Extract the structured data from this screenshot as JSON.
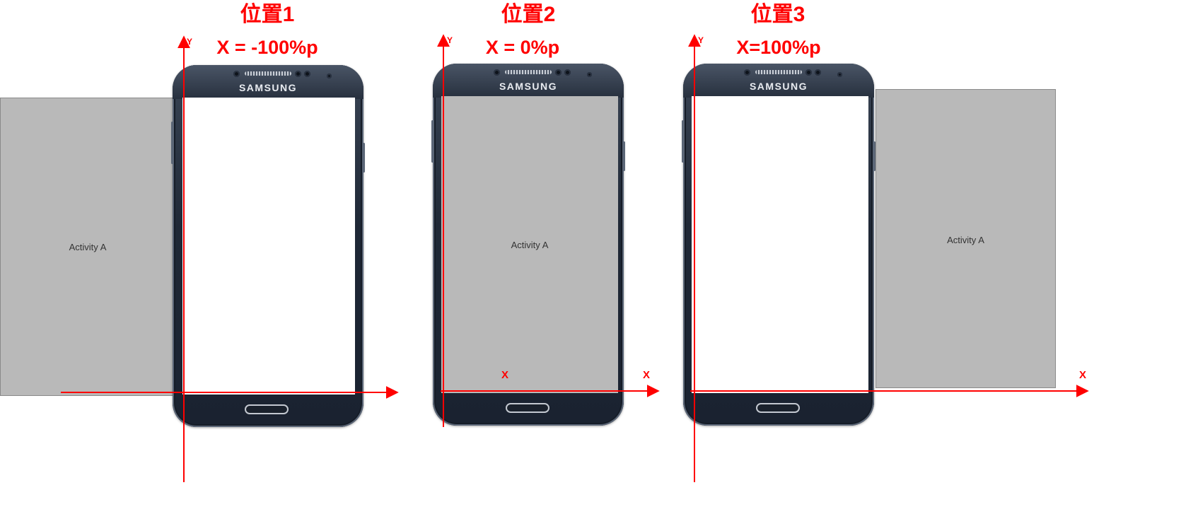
{
  "positions": [
    {
      "title": "位置1",
      "formula": "X = -100%p",
      "activity_label": "Activity A",
      "brand": "SAMSUNG",
      "y_axis_label": "Y",
      "x_axis_label": ""
    },
    {
      "title": "位置2",
      "formula": "X = 0%p",
      "activity_label": "Activity A",
      "brand": "SAMSUNG",
      "y_axis_label": "Y",
      "x_axis_label": "X",
      "x_marker_label": "X"
    },
    {
      "title": "位置3",
      "formula": "X=100%p",
      "activity_label": "Activity A",
      "brand": "SAMSUNG",
      "y_axis_label": "Y",
      "x_axis_label": "X"
    }
  ],
  "colors": {
    "axis": "#ff0000",
    "title": "#ff0000",
    "activity_fill": "#b9b9b9",
    "screen": "#ffffff",
    "phone_body": "#1f2836"
  }
}
